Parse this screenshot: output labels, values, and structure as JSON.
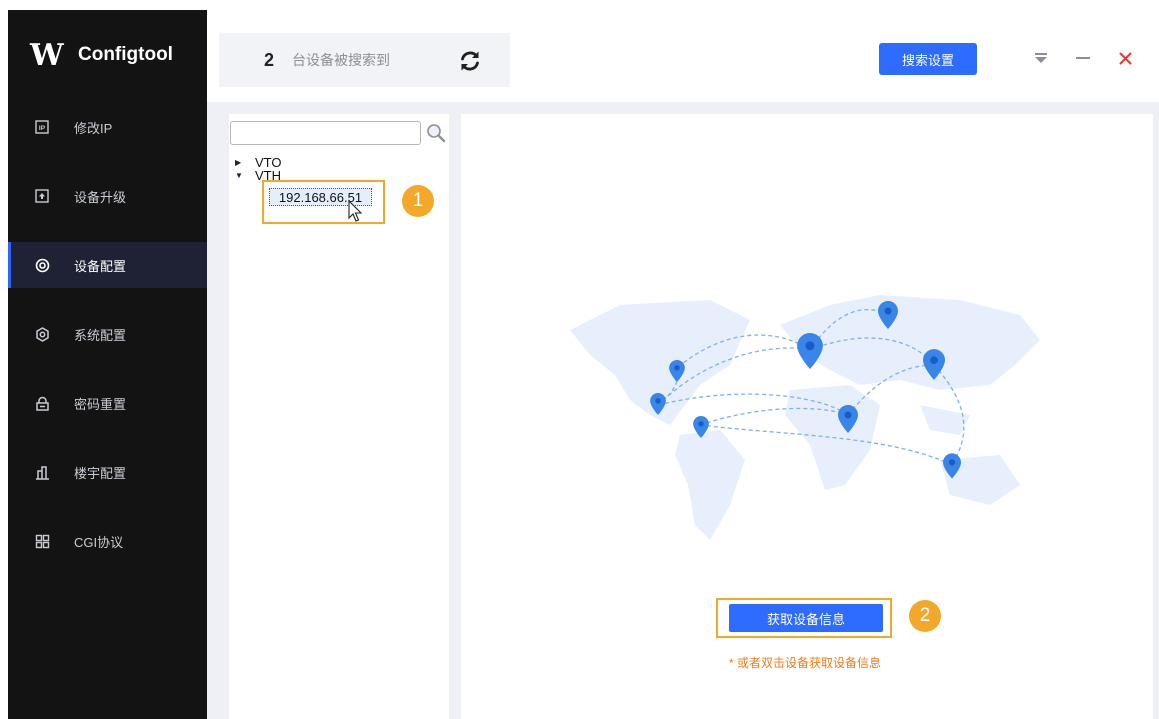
{
  "app": {
    "logo_text": "W",
    "name": "Configtool"
  },
  "sidebar": {
    "items": [
      {
        "label": "修改IP",
        "icon": "ip-icon"
      },
      {
        "label": "设备升级",
        "icon": "upgrade-icon"
      },
      {
        "label": "设备配置",
        "icon": "target-icon",
        "active": true
      },
      {
        "label": "系统配置",
        "icon": "hexagon-settings-icon"
      },
      {
        "label": "密码重置",
        "icon": "lock-icon"
      },
      {
        "label": "楼宇配置",
        "icon": "building-icon"
      },
      {
        "label": "CGI协议",
        "icon": "grid-icon"
      }
    ]
  },
  "header": {
    "device_count": "2",
    "device_count_label": "台设备被搜索到",
    "search_settings_label": "搜索设置"
  },
  "tree": {
    "search_placeholder": "",
    "nodes": [
      {
        "label": "VTO",
        "expanded": false
      },
      {
        "label": "VTH",
        "expanded": true,
        "children": [
          "192.168.66.51"
        ]
      }
    ]
  },
  "callouts": {
    "step1": "1",
    "step2": "2"
  },
  "main": {
    "get_info_button": "获取设备信息",
    "hint": "* 或者双击设备获取设备信息"
  },
  "colors": {
    "sidebar_bg": "#131314",
    "accent": "#2e6bff",
    "highlight": "#f4a82a",
    "close_red": "#e53935",
    "hint_orange": "#f07d1c"
  }
}
